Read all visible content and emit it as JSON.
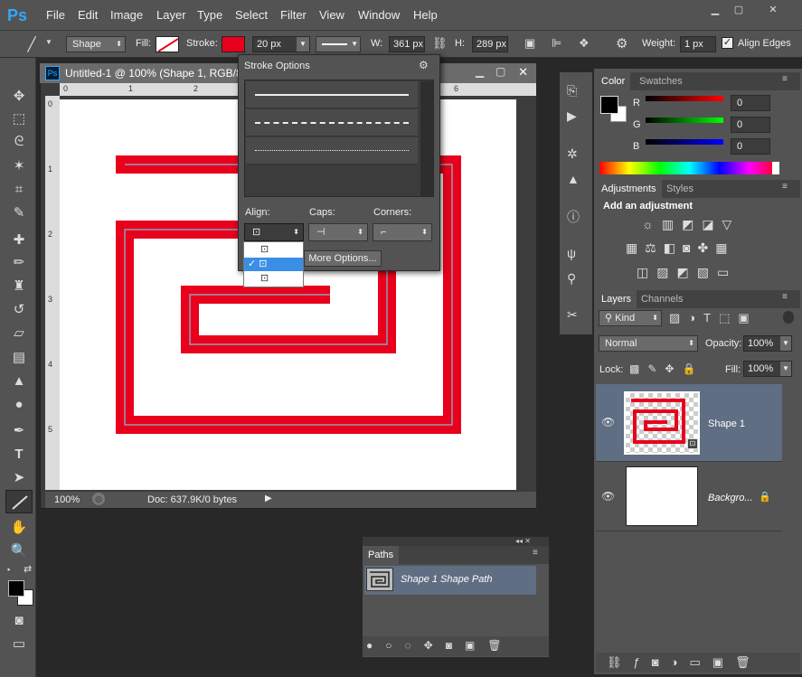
{
  "menu": [
    "File",
    "Edit",
    "Image",
    "Layer",
    "Type",
    "Select",
    "Filter",
    "View",
    "Window",
    "Help"
  ],
  "window_controls": [
    "▁",
    "▢",
    "✕"
  ],
  "options": {
    "shape_mode": "Shape",
    "fill_label": "Fill:",
    "stroke_label": "Stroke:",
    "stroke_width": "20 px",
    "w_label": "W:",
    "w_value": "361 px",
    "h_label": "H:",
    "h_value": "289 px",
    "weight_label": "Weight:",
    "weight_value": "1 px",
    "align_edges": "Align Edges",
    "stroke_color": "#e8001c"
  },
  "document": {
    "tab_title": "Untitled-1 @ 100% (Shape 1, RGB/8)",
    "zoom": "100%",
    "doc_info": "Doc: 637.9K/0 bytes",
    "ruler_h": [
      "0",
      "1",
      "2",
      "6"
    ],
    "ruler_v": [
      "0",
      "1",
      "2",
      "3",
      "4",
      "5"
    ]
  },
  "stroke_panel": {
    "title": "Stroke Options",
    "align_label": "Align:",
    "caps_label": "Caps:",
    "corners_label": "Corners:",
    "more_options": "More Options..."
  },
  "color_panel": {
    "tabs": [
      "Color",
      "Swatches"
    ],
    "r_label": "R",
    "g_label": "G",
    "b_label": "B",
    "r": "0",
    "g": "0",
    "b": "0"
  },
  "adjustments_panel": {
    "tabs": [
      "Adjustments",
      "Styles"
    ],
    "heading": "Add an adjustment"
  },
  "layers_panel": {
    "tabs": [
      "Layers",
      "Channels"
    ],
    "kind": "Kind",
    "blend": "Normal",
    "opacity_label": "Opacity:",
    "opacity": "100%",
    "lock_label": "Lock:",
    "fill_label": "Fill:",
    "fill": "100%",
    "layers": [
      {
        "name": "Shape 1"
      },
      {
        "name": "Backgro..."
      }
    ]
  },
  "paths_panel": {
    "tab": "Paths",
    "path_name": "Shape 1 Shape Path"
  },
  "colors": {
    "accent": "#3a8ee6",
    "stroke_red": "#e8001c"
  }
}
